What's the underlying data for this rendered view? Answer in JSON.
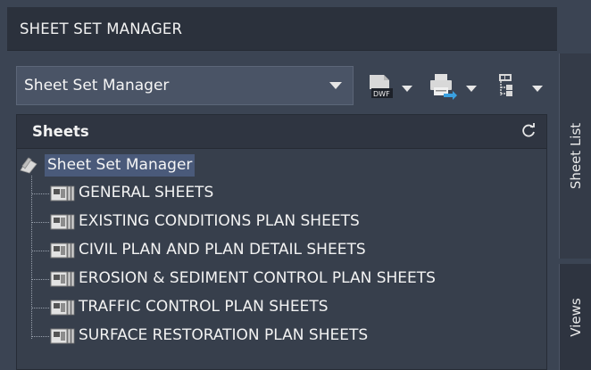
{
  "window": {
    "title": "SHEET SET MANAGER"
  },
  "toolbar": {
    "dropdown_value": "Sheet Set Manager",
    "publish_icon_text": "DWF"
  },
  "side_tabs": [
    {
      "label": "Sheet List",
      "active": true
    },
    {
      "label": "Views",
      "active": false
    }
  ],
  "sheets_panel": {
    "header": "Sheets",
    "root": {
      "label": "Sheet Set Manager",
      "selected": true
    },
    "items": [
      {
        "label": "GENERAL SHEETS"
      },
      {
        "label": "EXISTING CONDITIONS PLAN SHEETS"
      },
      {
        "label": "CIVIL PLAN AND PLAN DETAIL SHEETS"
      },
      {
        "label": "EROSION & SEDIMENT CONTROL PLAN SHEETS"
      },
      {
        "label": "TRAFFIC CONTROL PLAN SHEETS"
      },
      {
        "label": "SURFACE RESTORATION PLAN SHEETS"
      }
    ]
  },
  "colors": {
    "background": "#3b4453",
    "titlebar": "#2b313c",
    "selection": "#4a5a7a",
    "accent_blue": "#3aa0e0"
  }
}
